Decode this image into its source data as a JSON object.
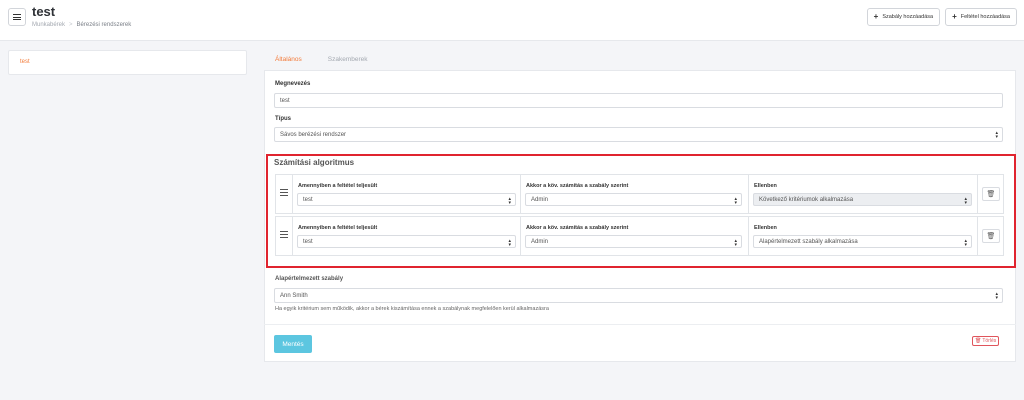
{
  "header": {
    "title": "test",
    "breadcrumb": [
      "Munkabérek",
      "Bérezési rendszerek"
    ],
    "breadcrumb_sep": ">",
    "actions": [
      {
        "label": "Szabály hozzáadása",
        "icon": "plus-icon"
      },
      {
        "label": "Feltétel hozzáadása",
        "icon": "plus-icon"
      }
    ]
  },
  "sidebar": {
    "items": [
      {
        "label": "test",
        "active": true
      }
    ]
  },
  "tabs": [
    {
      "label": "Általános",
      "active": true
    },
    {
      "label": "Szakemberek",
      "active": false
    }
  ],
  "form": {
    "name_label": "Megnevezés",
    "name_value": "test",
    "type_label": "Típus",
    "type_value": "Sávos berézési rendszer",
    "algorithm_title": "Számítási algoritmus",
    "rules": [
      {
        "condition_label": "Amennyiben a feltétel teljesült",
        "condition_value": "test",
        "next_label": "Akkor a köv. számítás a szabály szerint",
        "next_value": "Admin",
        "else_label": "Ellenben",
        "else_value": "Következő kritériumok alkalmazása",
        "else_disabled": true
      },
      {
        "condition_label": "Amennyiben a feltétel teljesült",
        "condition_value": "test",
        "next_label": "Akkor a köv. számítás a szabály szerint",
        "next_value": "Admin",
        "else_label": "Ellenben",
        "else_value": "Alapértelmezett szabály alkalmazása",
        "else_disabled": false
      }
    ],
    "default_rule_label": "Alapértelmezett szabály",
    "default_rule_value": "Ann Smith",
    "helper_text": "Ha egyik kritérium sem működik, akkor a bérek kiszámítása ennek a szabálynak megfelelően kerül alkalmazásra"
  },
  "buttons": {
    "save": "Mentés",
    "delete": "Törlés"
  },
  "colors": {
    "accent": "#f37b3a",
    "save": "#5cc6e0",
    "danger": "#e0242f"
  }
}
